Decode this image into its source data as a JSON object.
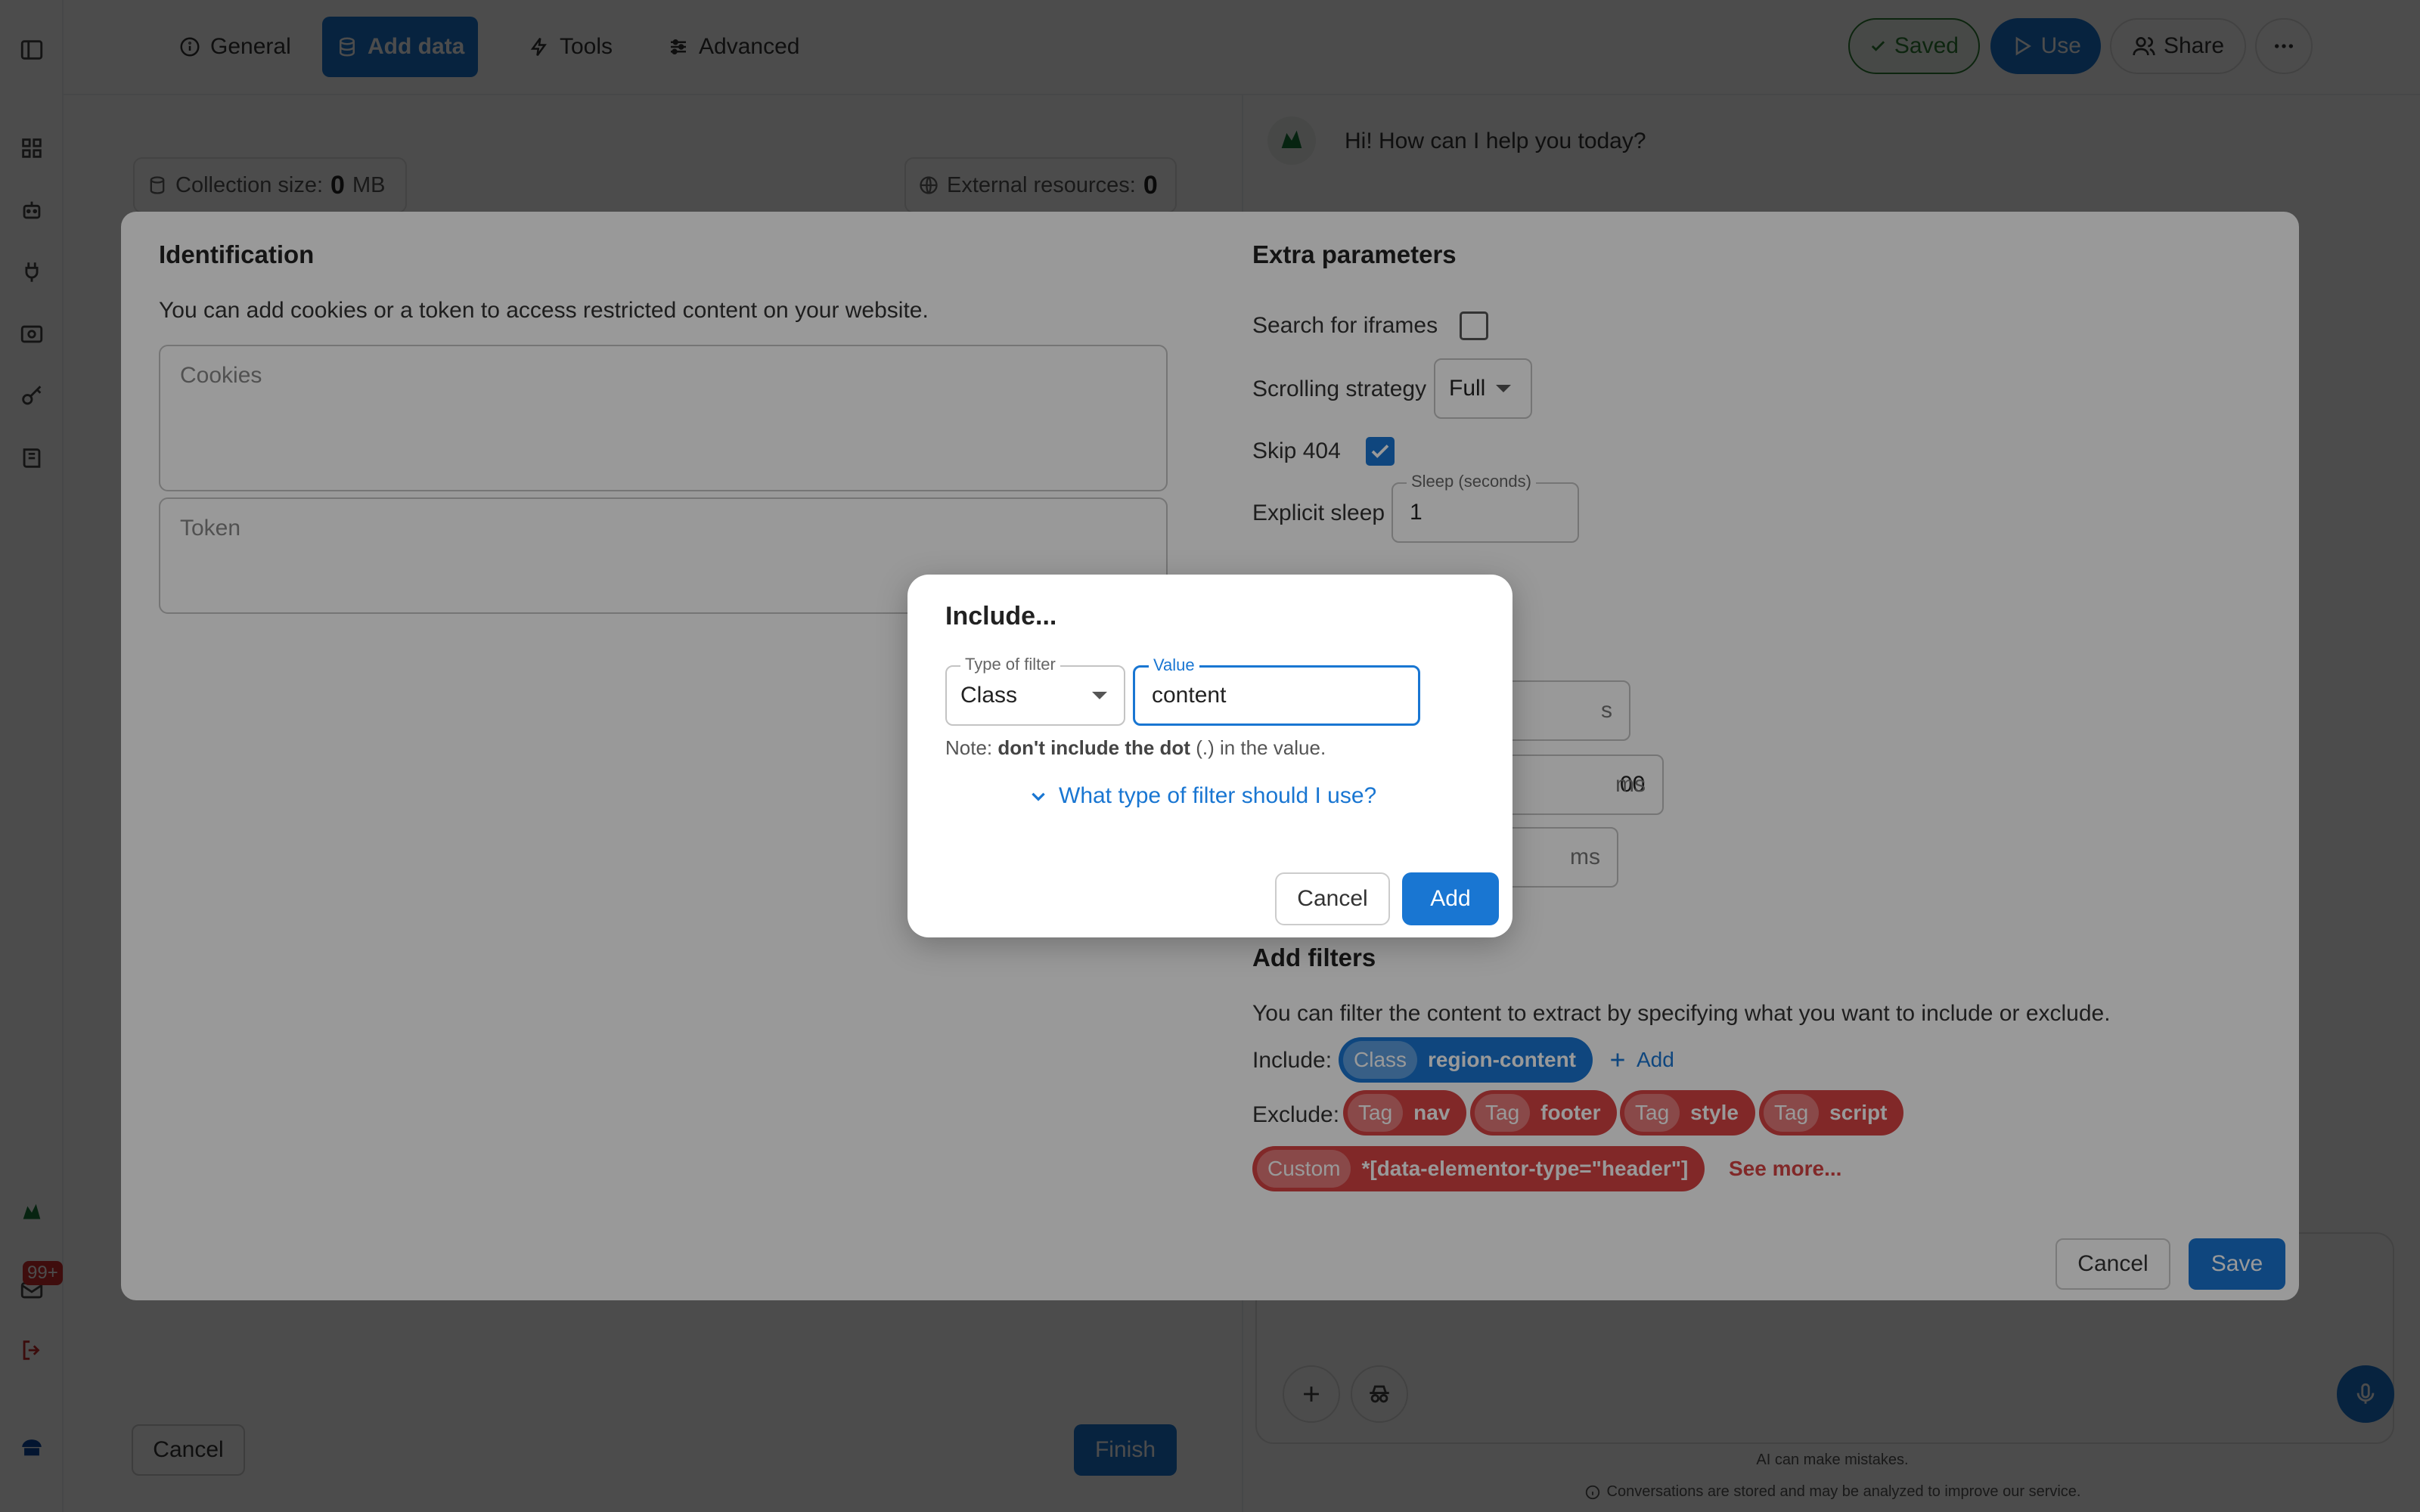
{
  "topbar": {
    "tabs": [
      {
        "label": "General",
        "icon": "info-icon"
      },
      {
        "label": "Add data",
        "icon": "database-icon"
      },
      {
        "label": "Tools",
        "icon": "lightning-icon"
      },
      {
        "label": "Advanced",
        "icon": "sliders-icon"
      }
    ],
    "saved_label": "Saved",
    "use_label": "Use",
    "share_label": "Share"
  },
  "sidebar": {
    "notification_count": "99+"
  },
  "left": {
    "collection_label": "Collection size:",
    "collection_value": "0",
    "collection_unit": "MB",
    "external_label": "External resources:",
    "external_value": "0",
    "cancel_label": "Cancel",
    "finish_label": "Finish"
  },
  "chat": {
    "greeting": "Hi! How can I help you today?",
    "disclaimer": "AI can make mistakes.",
    "privacy": "Conversations are stored and may be analyzed to improve our service."
  },
  "modal": {
    "identification": {
      "heading": "Identification",
      "description": "You can add cookies or a token to access restricted content on your website.",
      "cookies_placeholder": "Cookies",
      "token_placeholder": "Token"
    },
    "extra": {
      "heading": "Extra parameters",
      "iframes_label": "Search for iframes",
      "iframes_checked": false,
      "scrolling_label": "Scrolling strategy",
      "scrolling_value": "Full",
      "skip404_label": "Skip 404",
      "skip404_checked": true,
      "sleep_label": "Explicit sleep",
      "sleep_field_label": "Sleep (seconds)",
      "sleep_value": "1",
      "unit_s": "s",
      "partial_value": "00",
      "unit_ms": "ms"
    },
    "filters": {
      "heading": "Add filters",
      "description": "You can filter the content to extract by specifying what you want to include or exclude.",
      "include_label": "Include:",
      "include": [
        {
          "type": "Class",
          "value": "region-content"
        }
      ],
      "add_label": "Add",
      "exclude_label": "Exclude:",
      "exclude": [
        {
          "type": "Tag",
          "value": "nav"
        },
        {
          "type": "Tag",
          "value": "footer"
        },
        {
          "type": "Tag",
          "value": "style"
        },
        {
          "type": "Tag",
          "value": "script"
        },
        {
          "type": "Custom",
          "value": "*[data-elementor-type=\"header\"]"
        }
      ],
      "see_more": "See more..."
    },
    "cancel_label": "Cancel",
    "save_label": "Save"
  },
  "dialog": {
    "title": "Include...",
    "filter_type_label": "Type of filter",
    "filter_type_value": "Class",
    "value_label": "Value",
    "value": "content",
    "note_prefix": "Note: ",
    "note_bold": "don't include the dot",
    "note_suffix": " (.) in the value.",
    "help_link": "What type of filter should I use?",
    "cancel_label": "Cancel",
    "add_label": "Add"
  },
  "colors": {
    "primary": "#1976d2",
    "danger": "#d84343",
    "success": "#2e7d32"
  }
}
